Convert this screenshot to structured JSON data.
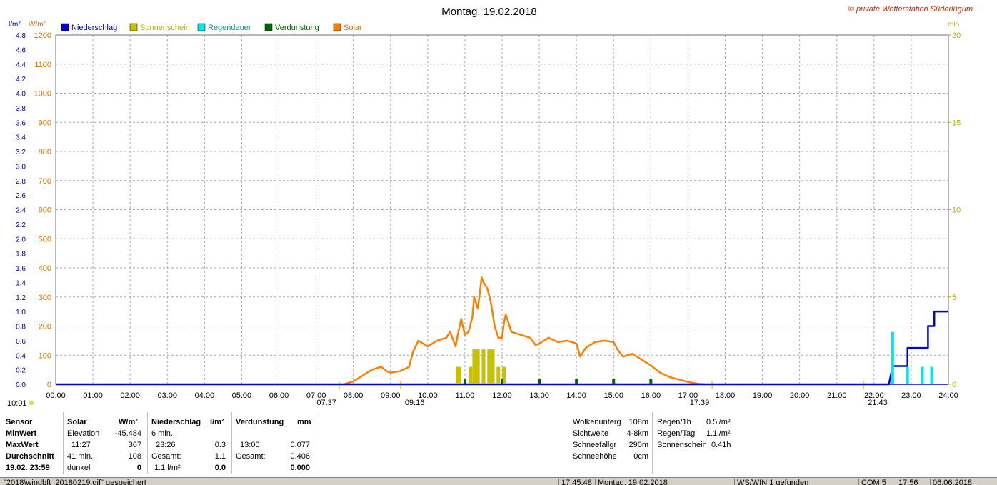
{
  "header": {
    "title": "Montag, 19.02.2018",
    "copyright": "© private Wetterstation Süderlügum",
    "unit_left1": "l/m²",
    "unit_left2": "W/m²",
    "unit_right": "min"
  },
  "colors": {
    "niederschlag": "#0000dd",
    "sonnenschein": "#c8c000",
    "regendauer": "#00e8e8",
    "verdunstung": "#006400",
    "solar": "#ff7f00",
    "axis_left1": "#0000aa",
    "axis_left2": "#e07000",
    "axis_right": "#b8b000"
  },
  "chart_data": {
    "type": "line",
    "title": "Montag, 19.02.2018",
    "x_ticks": [
      "00:00",
      "01:00",
      "02:00",
      "03:00",
      "04:00",
      "05:00",
      "06:00",
      "07:00",
      "08:00",
      "09:00",
      "10:00",
      "11:00",
      "12:00",
      "13:00",
      "14:00",
      "15:00",
      "16:00",
      "17:00",
      "18:00",
      "19:00",
      "20:00",
      "21:00",
      "22:00",
      "23:00",
      "24:00"
    ],
    "xlim_hours": [
      0,
      24
    ],
    "y_left1": {
      "unit": "l/m²",
      "lim": [
        0,
        4.8
      ],
      "ticks": [
        "0.0",
        "0.2",
        "0.4",
        "0.6",
        "0.8",
        "1.0",
        "1.2",
        "1.4",
        "1.6",
        "1.8",
        "2.0",
        "2.2",
        "2.4",
        "2.6",
        "2.8",
        "3.0",
        "3.2",
        "3.4",
        "3.6",
        "3.8",
        "4.0",
        "4.2",
        "4.4",
        "4.6",
        "4.8"
      ]
    },
    "y_left2": {
      "unit": "W/m²",
      "lim": [
        0,
        1200
      ],
      "ticks": [
        "0",
        "100",
        "200",
        "300",
        "400",
        "500",
        "600",
        "700",
        "800",
        "900",
        "1000",
        "1100",
        "1200"
      ]
    },
    "y_right": {
      "unit": "min",
      "lim": [
        0,
        20
      ],
      "ticks": [
        "0",
        "5",
        "10",
        "15",
        "20"
      ]
    },
    "grid": true,
    "legend": [
      "Niederschlag",
      "Sonnenschein",
      "Regendauer",
      "Verdunstung",
      "Solar"
    ],
    "series": [
      {
        "name": "Solar",
        "axis": "W/m²",
        "x": [
          7.75,
          8.0,
          8.25,
          8.5,
          8.75,
          8.9,
          9.0,
          9.25,
          9.5,
          9.6,
          9.75,
          10.0,
          10.25,
          10.5,
          10.6,
          10.75,
          10.8,
          10.9,
          11.0,
          11.1,
          11.2,
          11.25,
          11.35,
          11.45,
          11.5,
          11.55,
          11.6,
          11.7,
          11.75,
          11.8,
          11.9,
          12.0,
          12.05,
          12.1,
          12.25,
          12.5,
          12.75,
          12.9,
          13.0,
          13.25,
          13.5,
          13.75,
          14.0,
          14.1,
          14.25,
          14.5,
          14.75,
          15.0,
          15.1,
          15.25,
          15.5,
          15.75,
          16.0,
          16.25,
          16.5,
          17.0,
          17.25,
          17.45
        ],
        "y": [
          0,
          10,
          30,
          50,
          60,
          45,
          40,
          45,
          60,
          110,
          150,
          130,
          150,
          160,
          180,
          130,
          165,
          225,
          170,
          180,
          230,
          300,
          260,
          367,
          350,
          340,
          330,
          280,
          240,
          200,
          160,
          160,
          210,
          240,
          180,
          170,
          160,
          135,
          140,
          160,
          145,
          150,
          140,
          95,
          125,
          145,
          150,
          145,
          120,
          95,
          105,
          85,
          65,
          40,
          25,
          8,
          2,
          0
        ]
      },
      {
        "name": "Niederschlag",
        "axis": "l/m²",
        "x": [
          0,
          22.4,
          22.5,
          22.9,
          22.9,
          23.45,
          23.45,
          23.62,
          23.62,
          24
        ],
        "y": [
          0,
          0,
          0.25,
          0.25,
          0.5,
          0.5,
          0.8,
          0.8,
          1.0,
          1.0
        ]
      },
      {
        "name": "Sonnenschein",
        "axis": "min",
        "type": "bar",
        "x": [
          10.8,
          10.85,
          11.15,
          11.25,
          11.35,
          11.5,
          11.65,
          11.75,
          11.9,
          12.05
        ],
        "y": [
          1.0,
          1.0,
          1.0,
          2.0,
          2.0,
          2.0,
          2.0,
          2.0,
          1.0,
          1.0
        ]
      },
      {
        "name": "Regendauer",
        "axis": "min",
        "type": "bar",
        "x": [
          22.5,
          22.9,
          23.3,
          23.55
        ],
        "y": [
          3.0,
          1.0,
          1.0,
          1.0
        ]
      },
      {
        "name": "Verdunstung",
        "axis": "min",
        "type": "bar",
        "x": [
          11.0,
          12.0,
          13.0,
          14.0,
          15.0,
          16.0
        ],
        "y": [
          0.3,
          0.3,
          0.3,
          0.3,
          0.3,
          0.3
        ]
      }
    ],
    "markers_bottom": [
      {
        "label": "10:01",
        "hour": -1
      },
      {
        "label": "07:37",
        "hour": 7.62
      },
      {
        "label": "09:16",
        "hour": 9.27
      },
      {
        "label": "17:39",
        "hour": 17.65
      },
      {
        "label": "21:43",
        "hour": 21.72
      }
    ]
  },
  "stats": {
    "headers": {
      "sensor": "Sensor",
      "solar": "Solar",
      "solar_unit": "W/m²",
      "nied": "Niederschlag",
      "nied_unit": "l/m²",
      "verd": "Verdunstung",
      "verd_unit": "mm"
    },
    "rowlabels": [
      "MinWert",
      "MaxWert",
      "Durchschnitt",
      "19.02. 23:59"
    ],
    "solar": {
      "r1a": "Elevation",
      "r1b": "-45.484",
      "r2a": "11:27",
      "r2b": "367",
      "r3a": "41 min.",
      "r3b": "108",
      "r4a": "dunkel",
      "r4b": "0"
    },
    "nied": {
      "r1a": "6 min.",
      "r1b": "",
      "r2a": "23:26",
      "r2b": "0.3",
      "r3a": "Gesamt:",
      "r3b": "1.1",
      "r4a": "1.1 l/m²",
      "r4b": "0.0"
    },
    "verd": {
      "r2a": "13:00",
      "r2b": "0.077",
      "r3a": "Gesamt:",
      "r3b": "0.406",
      "r4b": "0.000"
    },
    "right1": [
      {
        "label": "Wolkenunterg",
        "value": "108m"
      },
      {
        "label": "Sichtweite",
        "value": "4-8km"
      },
      {
        "label": "Schneefallgr",
        "value": "290m"
      },
      {
        "label": "Schneehöhe",
        "value": "0cm"
      }
    ],
    "right2": [
      {
        "label": "Regen/1h",
        "value": "0.5l/m²"
      },
      {
        "label": "Regen/Tag",
        "value": "1.1l/m²"
      },
      {
        "label": "Sonnenschein",
        "value": "0.41h"
      }
    ]
  },
  "statusbar": {
    "msg": "\"2018\\windbft_20180219.gif\"  gespeichert",
    "time1": "17:45:48",
    "date": "Montag, 19.02.2018",
    "ws": "WS/WIN 1 gefunden",
    "com": "COM 5",
    "time2": "17:56",
    "date2": "06.06.2018"
  }
}
